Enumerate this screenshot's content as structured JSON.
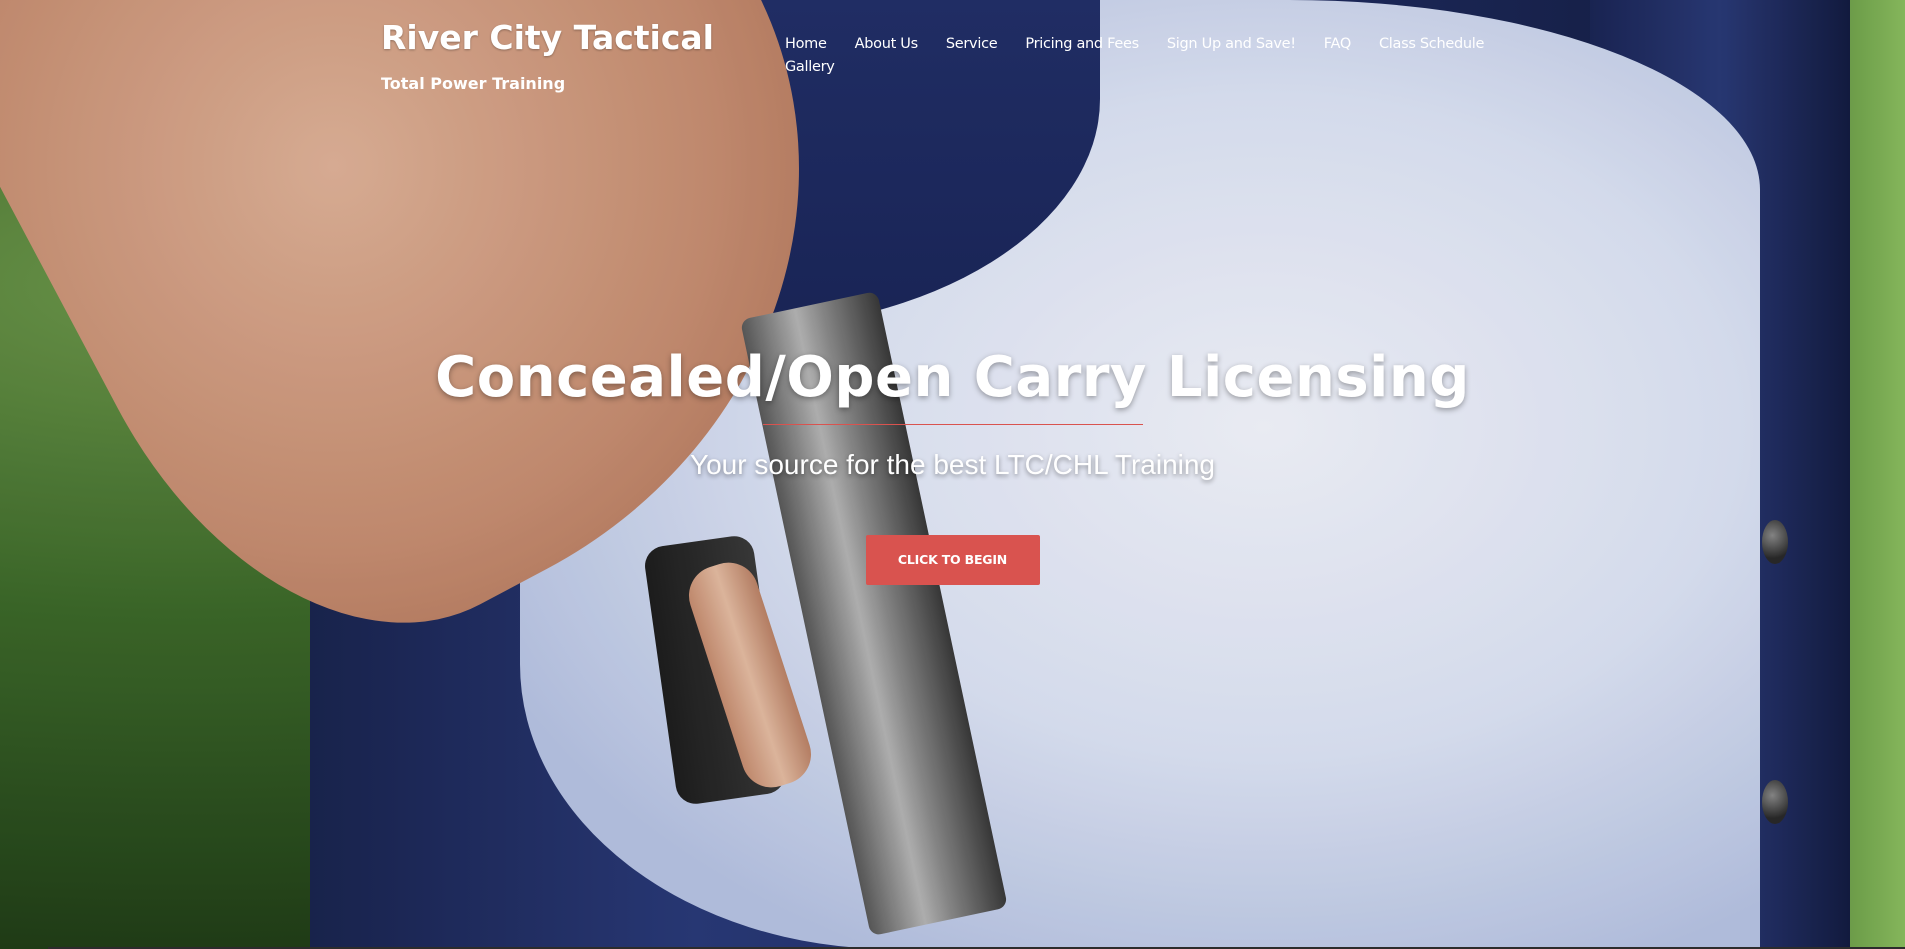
{
  "site": {
    "title": "River City Tactical",
    "tagline": "Total Power Training"
  },
  "nav": {
    "items": [
      {
        "label": "Home"
      },
      {
        "label": "About Us"
      },
      {
        "label": "Service"
      },
      {
        "label": "Pricing and Fees"
      },
      {
        "label": "Sign Up and Save!"
      },
      {
        "label": "FAQ"
      },
      {
        "label": "Class Schedule"
      },
      {
        "label": "Gallery"
      }
    ]
  },
  "hero": {
    "title": "Concealed/Open Carry Licensing",
    "subtitle": "Your source for the best LTC/CHL Training",
    "cta_label": "CLICK TO BEGIN",
    "accent_color": "#d9534f"
  }
}
